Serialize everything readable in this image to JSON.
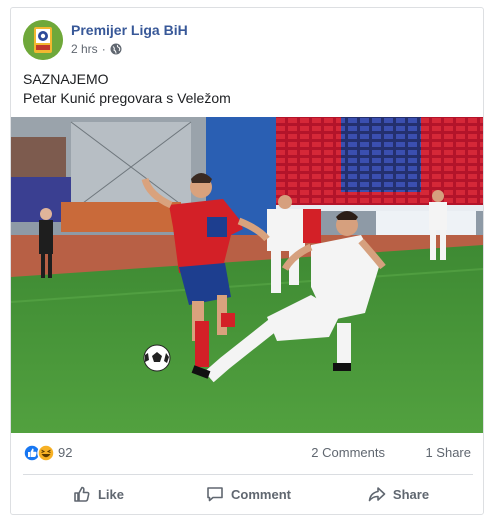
{
  "post": {
    "page_name": "Premijer Liga BiH",
    "time": "2 hrs",
    "separator": "·",
    "text_line1": "SAZNAJEMO",
    "text_line2": "Petar Kunić pregovara s Veležom"
  },
  "stats": {
    "reactions_count": "92",
    "comments": "2 Comments",
    "shares": "1 Share"
  },
  "actions": {
    "like": "Like",
    "comment": "Comment",
    "share": "Share"
  },
  "colors": {
    "page_name": "#385898",
    "secondary_text": "#606770",
    "like_blue": "#1877f2",
    "haha_yellow": "#f7b125",
    "jersey_red": "#d32027",
    "jersey_blue": "#1d3e8f"
  },
  "icons": {
    "reactions": [
      "like-reaction-icon",
      "haha-reaction-icon"
    ],
    "privacy": "globe-icon"
  }
}
